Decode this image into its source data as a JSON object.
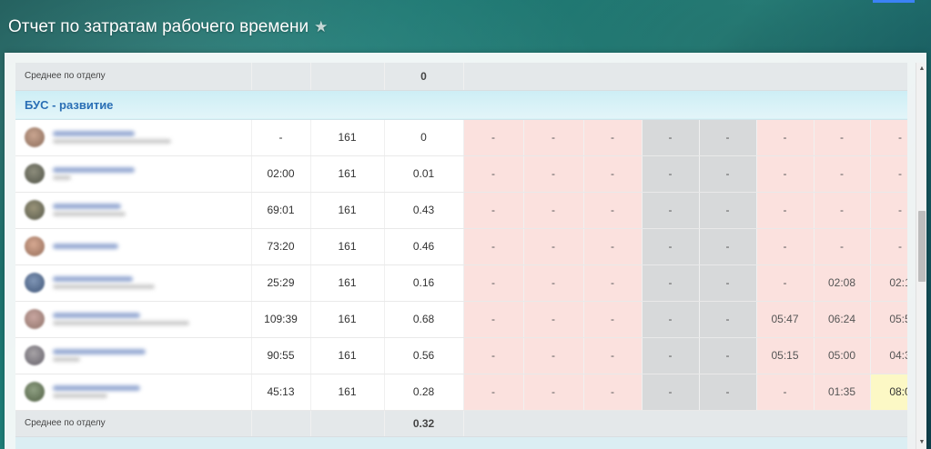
{
  "page": {
    "title": "Отчет по затратам рабочего времени"
  },
  "table": {
    "avg_top": {
      "label": "Среднее по отделу",
      "value": "0"
    },
    "group": {
      "name": "БУС - развитие"
    },
    "rows": [
      {
        "c": [
          "-",
          "161",
          "0"
        ],
        "d": [
          "-",
          "-",
          "-",
          "-",
          "-",
          "-",
          "-",
          "-"
        ]
      },
      {
        "c": [
          "02:00",
          "161",
          "0.01"
        ],
        "d": [
          "-",
          "-",
          "-",
          "-",
          "-",
          "-",
          "-",
          "-"
        ]
      },
      {
        "c": [
          "69:01",
          "161",
          "0.43"
        ],
        "d": [
          "-",
          "-",
          "-",
          "-",
          "-",
          "-",
          "-",
          "-"
        ]
      },
      {
        "c": [
          "73:20",
          "161",
          "0.46"
        ],
        "d": [
          "-",
          "-",
          "-",
          "-",
          "-",
          "-",
          "-",
          "-"
        ]
      },
      {
        "c": [
          "25:29",
          "161",
          "0.16"
        ],
        "d": [
          "-",
          "-",
          "-",
          "-",
          "-",
          "-",
          "02:08",
          "02:1"
        ]
      },
      {
        "c": [
          "109:39",
          "161",
          "0.68"
        ],
        "d": [
          "-",
          "-",
          "-",
          "-",
          "-",
          "05:47",
          "06:24",
          "05:5"
        ]
      },
      {
        "c": [
          "90:55",
          "161",
          "0.56"
        ],
        "d": [
          "-",
          "-",
          "-",
          "-",
          "-",
          "05:15",
          "05:00",
          "04:3"
        ]
      },
      {
        "c": [
          "45:13",
          "161",
          "0.28"
        ],
        "d": [
          "-",
          "-",
          "-",
          "-",
          "-",
          "-",
          "01:35",
          "08:0"
        ]
      }
    ],
    "avg_bottom": {
      "label": "Среднее по отделу",
      "value": "0.32"
    }
  }
}
